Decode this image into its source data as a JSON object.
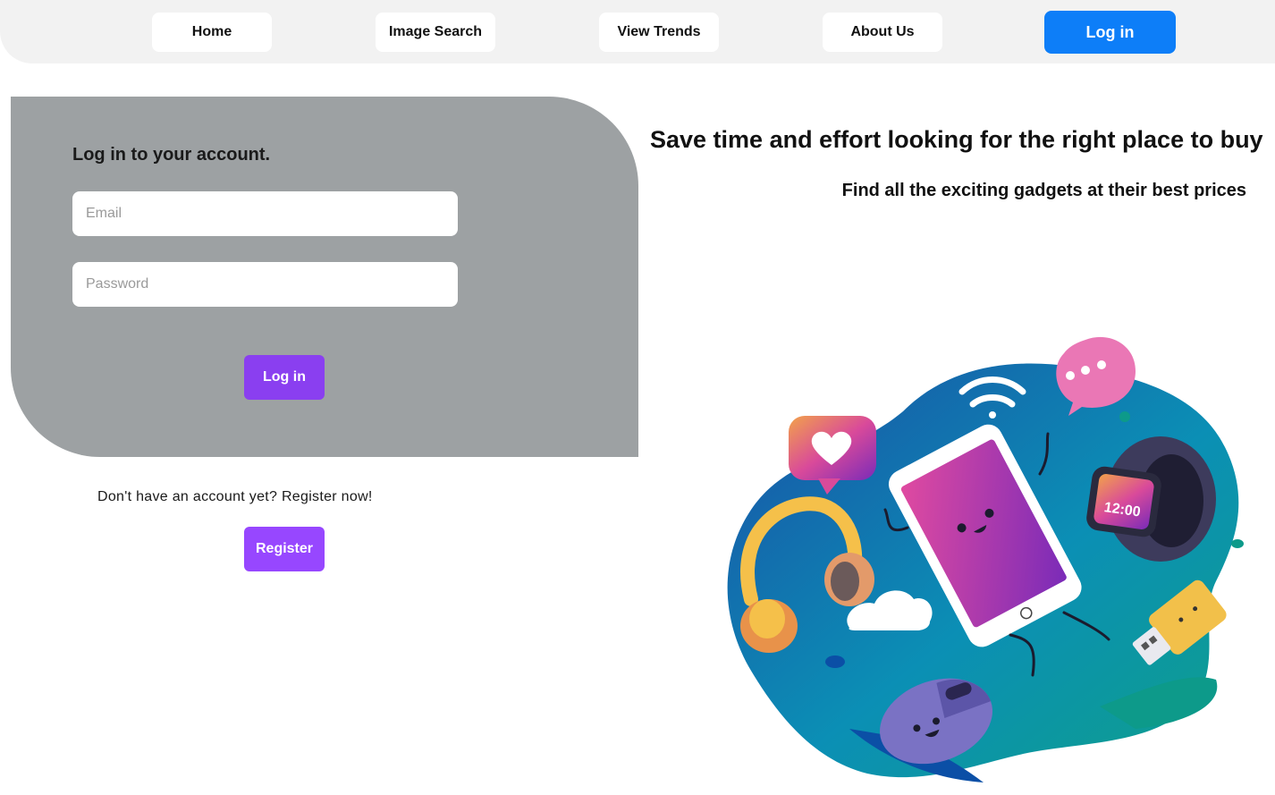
{
  "nav": {
    "items": [
      {
        "label": "Home"
      },
      {
        "label": "Image Search"
      },
      {
        "label": "View Trends"
      },
      {
        "label": "About Us"
      }
    ],
    "login_label": "Log in",
    "login_color": "#0d7ef8"
  },
  "login_form": {
    "title": "Log in to your account.",
    "email": {
      "value": "",
      "placeholder": "Email"
    },
    "password": {
      "value": "",
      "placeholder": "Password"
    },
    "submit_label": "Log in",
    "submit_color": "#8a3ff0",
    "card_color": "#9da1a3"
  },
  "register": {
    "prompt": "Don't have an account yet? Register now!",
    "button_label": "Register",
    "button_color": "#9747ff"
  },
  "hero": {
    "title": "Save time and effort looking for the right place to buy",
    "subtitle": "Find all the exciting gadgets at their best prices",
    "illustration": {
      "watch_time": "12:00",
      "icons": [
        "heart-icon",
        "wifi-icon",
        "chat-bubble-icon",
        "tablet-icon",
        "smartwatch-icon",
        "headphones-icon",
        "cloud-icon",
        "mouse-icon",
        "usb-drive-icon"
      ]
    }
  }
}
